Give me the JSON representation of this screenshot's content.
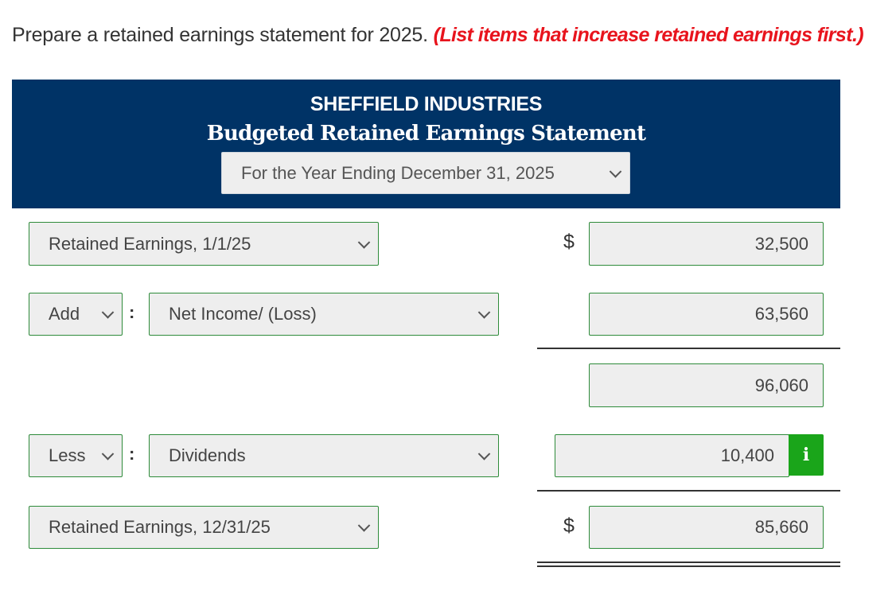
{
  "instruction": {
    "text": "Prepare a retained earnings statement for 2025.",
    "note": "(List items that increase retained earnings first.)"
  },
  "header": {
    "company": "SHEFFIELD INDUSTRIES",
    "title": "Budgeted Retained Earnings Statement",
    "period": "For the Year Ending December 31, 2025"
  },
  "rows": {
    "beginning": {
      "label": "Retained Earnings, 1/1/25",
      "currency": "$",
      "amount": "32,500"
    },
    "add": {
      "operator": "Add",
      "label": "Net Income/ (Loss)",
      "amount": "63,560"
    },
    "subtotal": {
      "amount": "96,060"
    },
    "less": {
      "operator": "Less",
      "label": "Dividends",
      "amount": "10,400"
    },
    "ending": {
      "label": "Retained Earnings, 12/31/25",
      "currency": "$",
      "amount": "85,660"
    }
  },
  "separator": ":",
  "info_icon": "i",
  "colors": {
    "header_bg": "#003366",
    "note_red": "#e8141d",
    "field_border": "#2e8b3a",
    "info_green": "#1aa51a"
  }
}
